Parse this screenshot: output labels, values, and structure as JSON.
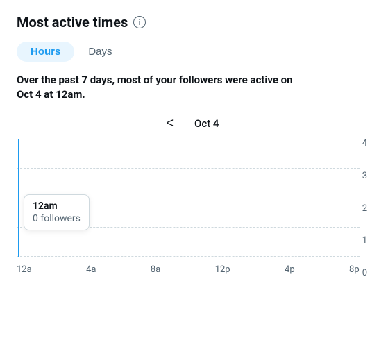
{
  "header": {
    "title": "Most active times",
    "info_label": "i"
  },
  "tabs": [
    {
      "id": "hours",
      "label": "Hours",
      "active": true
    },
    {
      "id": "days",
      "label": "Days",
      "active": false
    }
  ],
  "description": "Over the past 7 days, most of your followers were active on Oct 4 at 12am.",
  "date_nav": {
    "prev_arrow": "<",
    "date": "Oct 4"
  },
  "chart": {
    "y_axis_labels": [
      "4",
      "3",
      "2",
      "1",
      "0"
    ],
    "x_axis_labels": [
      "12a",
      "4a",
      "8a",
      "12p",
      "4p",
      "8p"
    ],
    "tooltip": {
      "time": "12am",
      "value": "0 followers"
    }
  }
}
